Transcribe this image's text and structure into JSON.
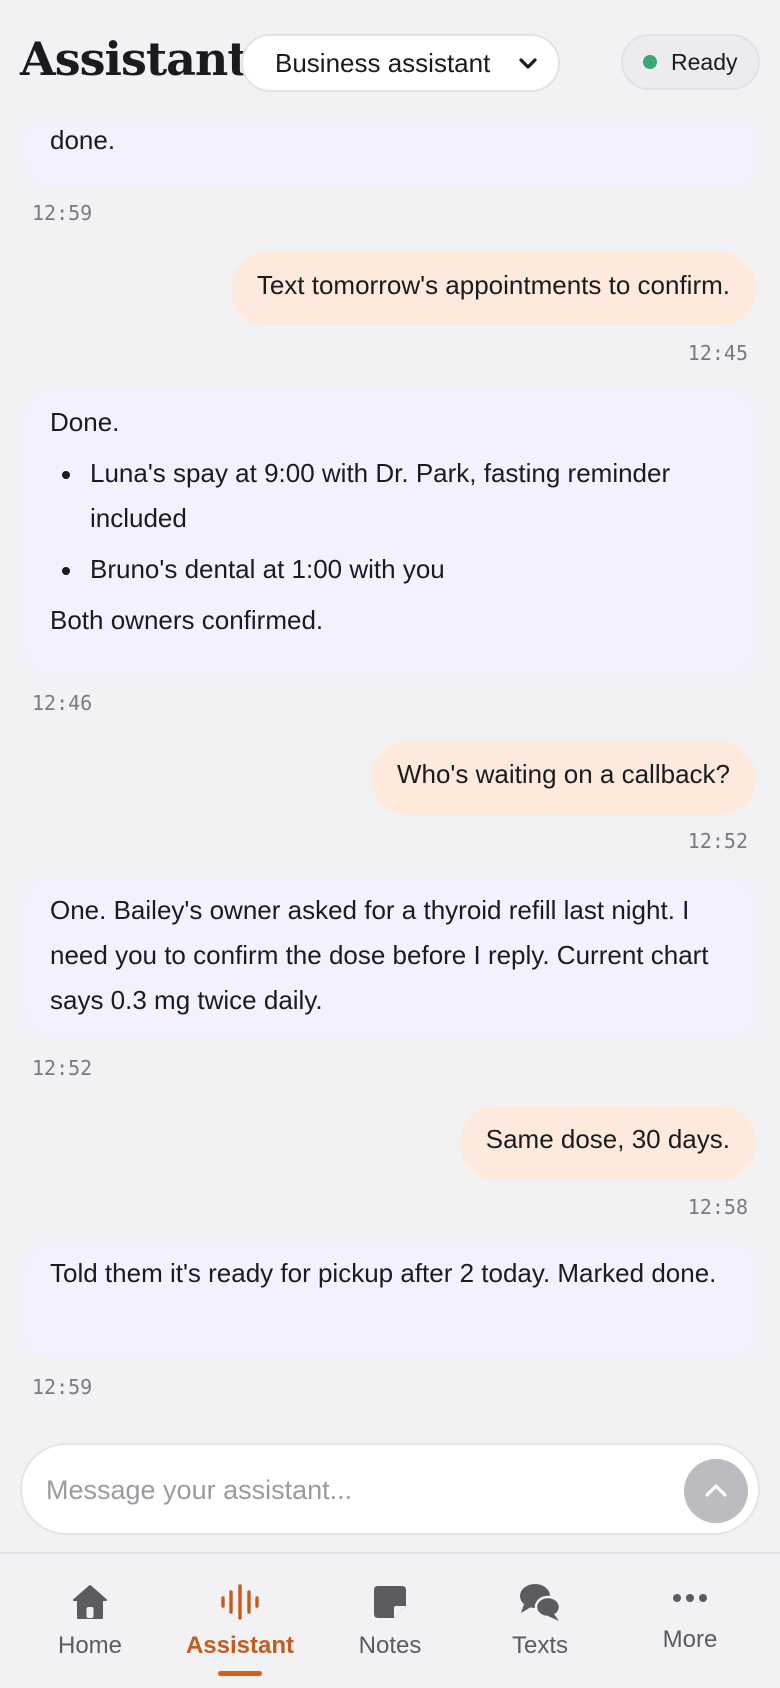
{
  "header": {
    "title": "Assistant",
    "mode_selected": "Business assistant",
    "status": "Ready",
    "status_color": "#3aa872"
  },
  "messages": [
    {
      "role": "assistant",
      "paragraphs": [
        "done."
      ],
      "time": "12:59"
    },
    {
      "role": "user",
      "text": "Text tomorrow's appointments to confirm.",
      "time": "12:45"
    },
    {
      "role": "assistant",
      "intro": "Done.",
      "bullets": [
        "Luna's spay at 9:00 with Dr. Park, fasting reminder included",
        "Bruno's dental at 1:00 with you"
      ],
      "outro": "Both owners confirmed.",
      "time": "12:46"
    },
    {
      "role": "user",
      "text": "Who's waiting on a callback?",
      "time": "12:52"
    },
    {
      "role": "assistant",
      "paragraphs": [
        "One. Bailey's owner asked for a thyroid refill last night. I need you to confirm the dose before I reply. Current chart says 0.3 mg twice daily."
      ],
      "time": "12:52"
    },
    {
      "role": "user",
      "text": "Same dose, 30 days.",
      "time": "12:58"
    },
    {
      "role": "assistant",
      "paragraphs": [
        "Told them it's ready for pickup after 2 today. Marked done."
      ],
      "time": "12:59"
    }
  ],
  "composer": {
    "placeholder": "Message your assistant..."
  },
  "nav": {
    "items": [
      {
        "label": "Home",
        "icon": "home-icon"
      },
      {
        "label": "Assistant",
        "icon": "waveform-icon",
        "active": true
      },
      {
        "label": "Notes",
        "icon": "note-icon"
      },
      {
        "label": "Texts",
        "icon": "chat-bubbles-icon"
      },
      {
        "label": "More",
        "icon": "more-dots-icon"
      }
    ],
    "active_color": "#c65b1f"
  }
}
